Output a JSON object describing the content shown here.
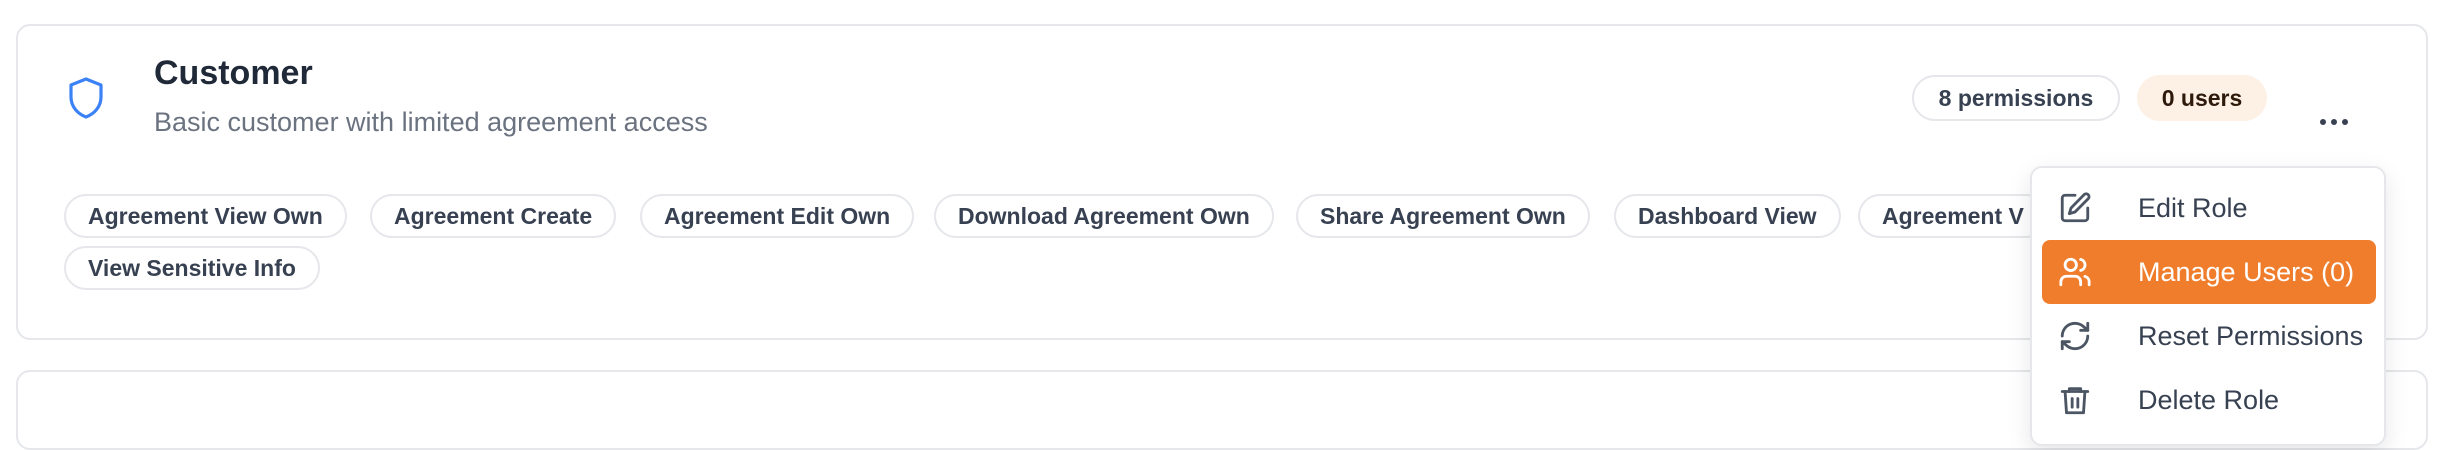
{
  "role": {
    "title": "Customer",
    "description": "Basic customer with limited agreement access",
    "icon": "shield-icon",
    "accent": "#3b82f6"
  },
  "badges": {
    "permissions": "8 permissions",
    "users": "0 users"
  },
  "permission_tags": [
    "Agreement View Own",
    "Agreement Create",
    "Agreement Edit Own",
    "Download Agreement Own",
    "Share Agreement Own",
    "Dashboard View",
    "Agreement V",
    "View Sensitive Info"
  ],
  "menu": {
    "items": [
      {
        "label": "Edit Role",
        "icon": "edit-icon"
      },
      {
        "label": "Manage Users (0)",
        "icon": "users-icon",
        "active": true
      },
      {
        "label": "Reset Permissions",
        "icon": "refresh-icon"
      },
      {
        "label": "Delete Role",
        "icon": "trash-icon"
      }
    ],
    "active_color": "#ef7d2c"
  }
}
